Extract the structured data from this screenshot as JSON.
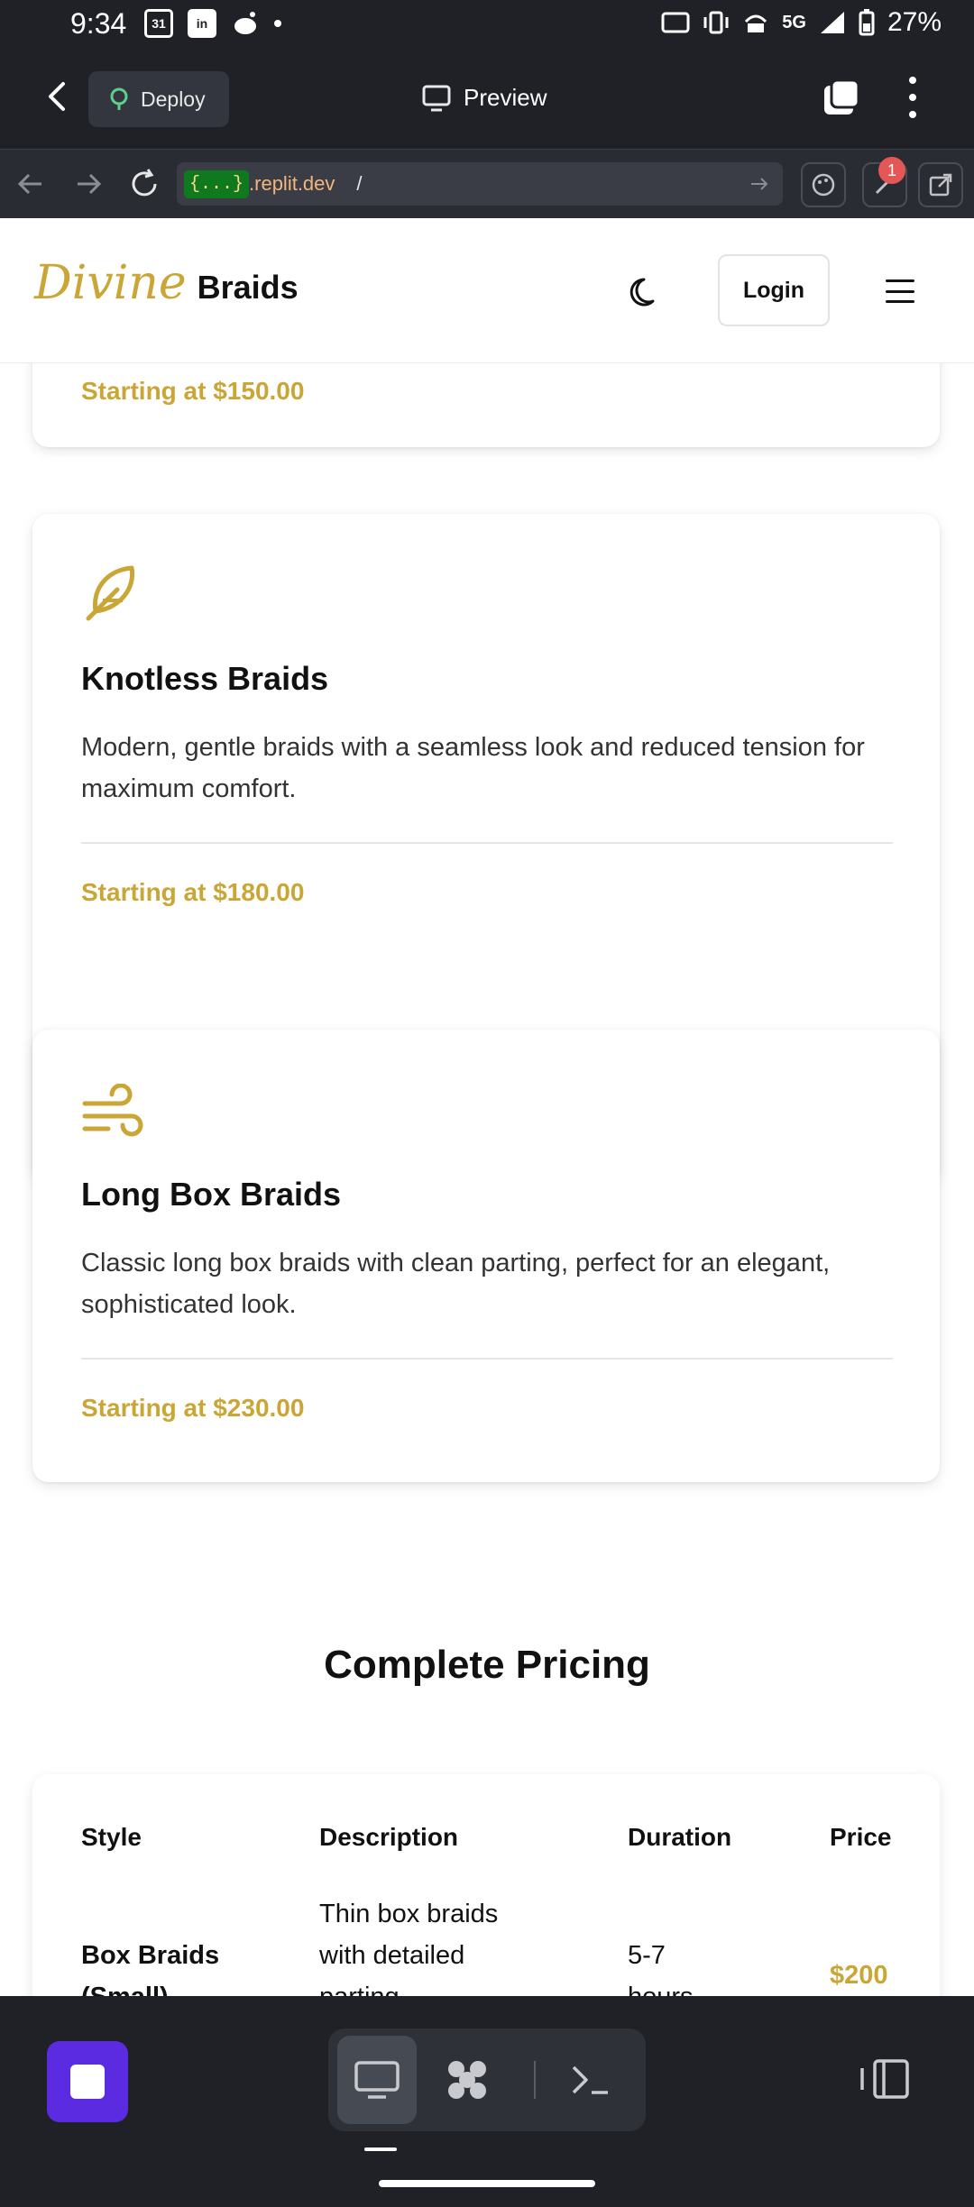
{
  "status_bar": {
    "time": "9:34",
    "calendar_day": "31",
    "network": "5G",
    "battery": "27%"
  },
  "toolbar": {
    "deploy_label": "Deploy",
    "preview_label": "Preview"
  },
  "url_bar": {
    "badge": "{...}",
    "host": ".replit.dev",
    "path": "/",
    "notification_count": "1"
  },
  "site": {
    "header_faded": "",
    "logo_script": "Divine",
    "logo_text": "Braids",
    "login_label": "Login"
  },
  "services": [
    {
      "title": "",
      "description": "",
      "price": "Starting at $150.00"
    },
    {
      "icon": "feather-icon",
      "title": "Knotless Braids",
      "description": "Modern, gentle braids with a seamless look and reduced tension for maximum comfort.",
      "price": "Starting at $180.00"
    },
    {
      "icon": "wind-icon",
      "title": "Long Box Braids",
      "description": "Classic long box braids with clean parting, perfect for an elegant, sophisticated look.",
      "price": "Starting at $230.00"
    }
  ],
  "pricing": {
    "title": "Complete Pricing",
    "headers": [
      "Style",
      "Description",
      "Duration",
      "Price"
    ],
    "rows": [
      {
        "style_line1": "Box Braids",
        "style_line2": "(Small)",
        "desc_line1": "Thin box braids",
        "desc_line2": "with detailed",
        "desc_line3": "parting",
        "dur_line1": "5-7",
        "dur_line2": "hours",
        "price": "$200"
      }
    ]
  },
  "colors": {
    "accent_gold": "#c9a635",
    "run_button": "#5a2be0",
    "chrome_dark": "#1f2127"
  }
}
